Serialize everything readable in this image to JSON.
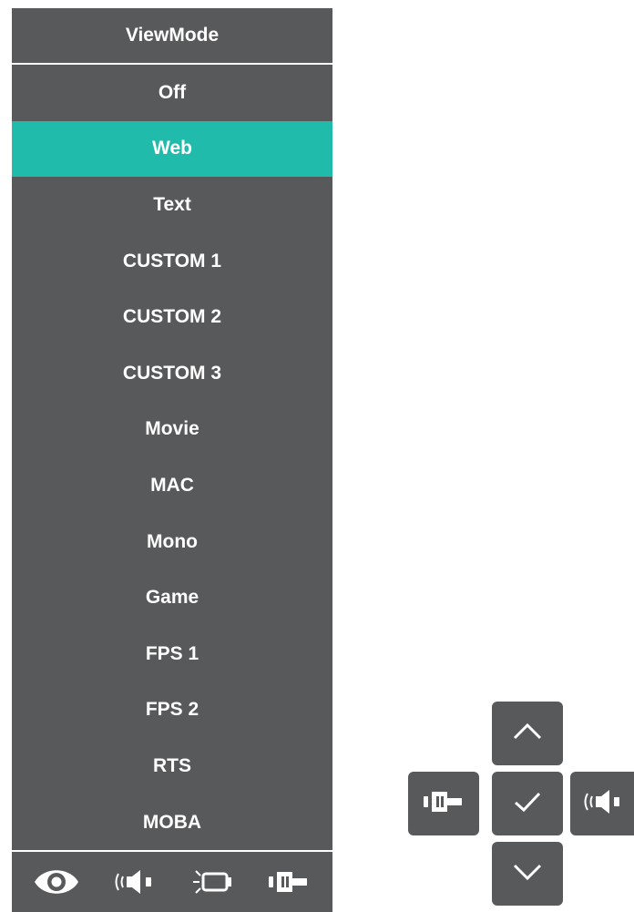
{
  "menu": {
    "title": "ViewMode",
    "selected_index": 1,
    "accent_color": "#20bbab",
    "panel_color": "#58595b",
    "items": [
      {
        "label": "Off"
      },
      {
        "label": "Web"
      },
      {
        "label": "Text"
      },
      {
        "label": "CUSTOM 1"
      },
      {
        "label": "CUSTOM 2"
      },
      {
        "label": "CUSTOM 3"
      },
      {
        "label": "Movie"
      },
      {
        "label": "MAC"
      },
      {
        "label": "Mono"
      },
      {
        "label": "Game"
      },
      {
        "label": "FPS 1"
      },
      {
        "label": "FPS 2"
      },
      {
        "label": "RTS"
      },
      {
        "label": "MOBA"
      }
    ]
  },
  "bottom_bar": {
    "icons": [
      "eye-icon",
      "speaker-icon",
      "light-bulb-icon",
      "input-source-icon"
    ]
  },
  "control_keys": {
    "up": "chevron-up-icon",
    "left": "input-source-icon",
    "center": "checkmark-icon",
    "right": "speaker-icon",
    "down": "chevron-down-icon"
  }
}
